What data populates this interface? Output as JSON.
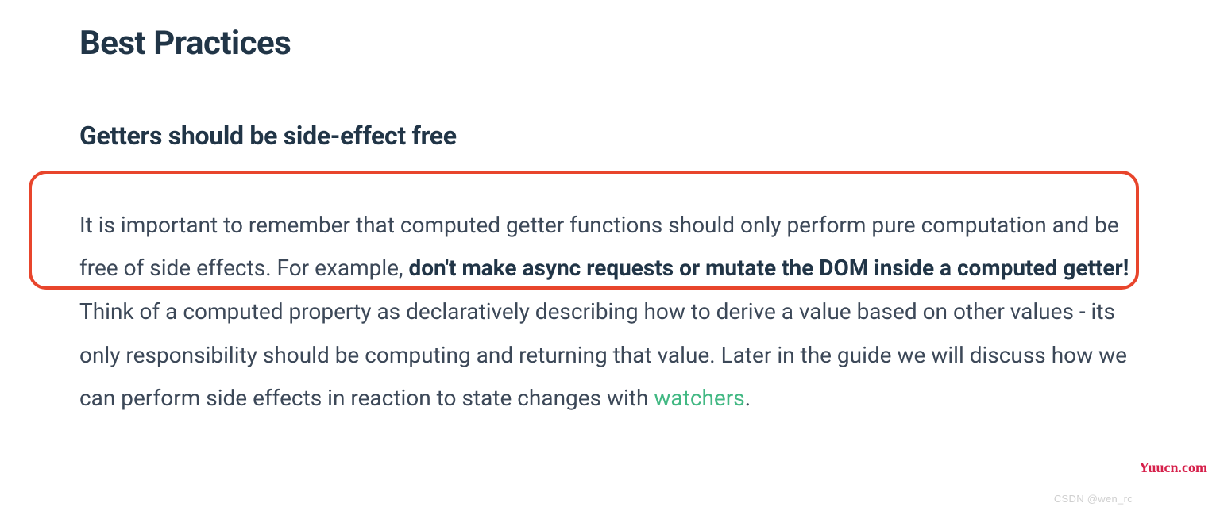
{
  "section": {
    "title": "Best Practices",
    "subtitle": "Getters should be side-effect free",
    "paragraph": {
      "part1": "It is important to remember that computed getter functions should only perform pure computation and be free of side effects. For example, ",
      "bold": "don't make async requests or mutate the DOM inside a computed getter!",
      "part2": " Think of a computed property as declaratively describing how to derive a value based on other values - its only responsibility should be computing and returning that value. Later in the guide we will discuss how we can perform side effects in reaction to state changes with ",
      "link": "watchers",
      "part3": "."
    }
  },
  "watermarks": {
    "right": "Yuucn.com",
    "center": "CSDN @wen_rc"
  }
}
